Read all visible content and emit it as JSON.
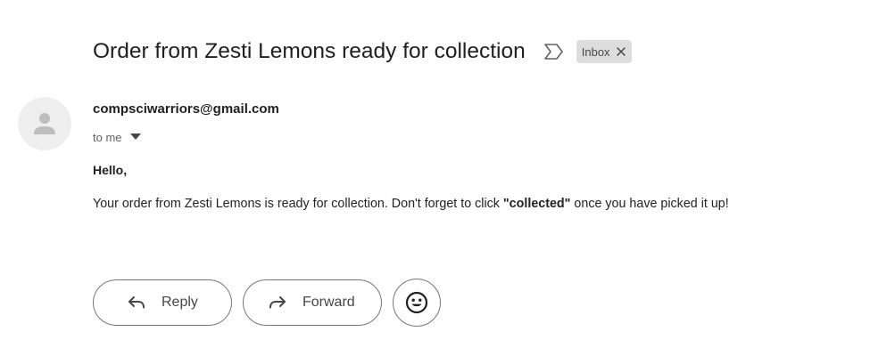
{
  "email": {
    "subject": "Order from Zesti Lemons ready for collection",
    "label_chip": "Inbox",
    "sender_email": "compsciwarriors@gmail.com",
    "recipient": "to me",
    "greeting": "Hello,",
    "body_before": "Your order from Zesti Lemons is ready for collection. Don't forget to click ",
    "body_emphasis": "\"collected\"",
    "body_after": " once you have picked it up!"
  },
  "actions": {
    "reply_label": "Reply",
    "forward_label": "Forward"
  },
  "icons": {
    "importance": "importance-marker-icon",
    "chip_close": "close-icon",
    "avatar": "default-person-avatar-icon",
    "recipient_details": "caret-down-icon",
    "reply": "reply-arrow-icon",
    "forward": "forward-arrow-icon",
    "emoji": "smiley-face-icon"
  },
  "colors": {
    "text_primary": "#1f1f1f",
    "text_secondary": "#5e5e5e",
    "chip_background": "#dddddd",
    "avatar_background": "#eeeeee",
    "avatar_glyph": "#bdbdbd",
    "button_border": "#747775"
  }
}
